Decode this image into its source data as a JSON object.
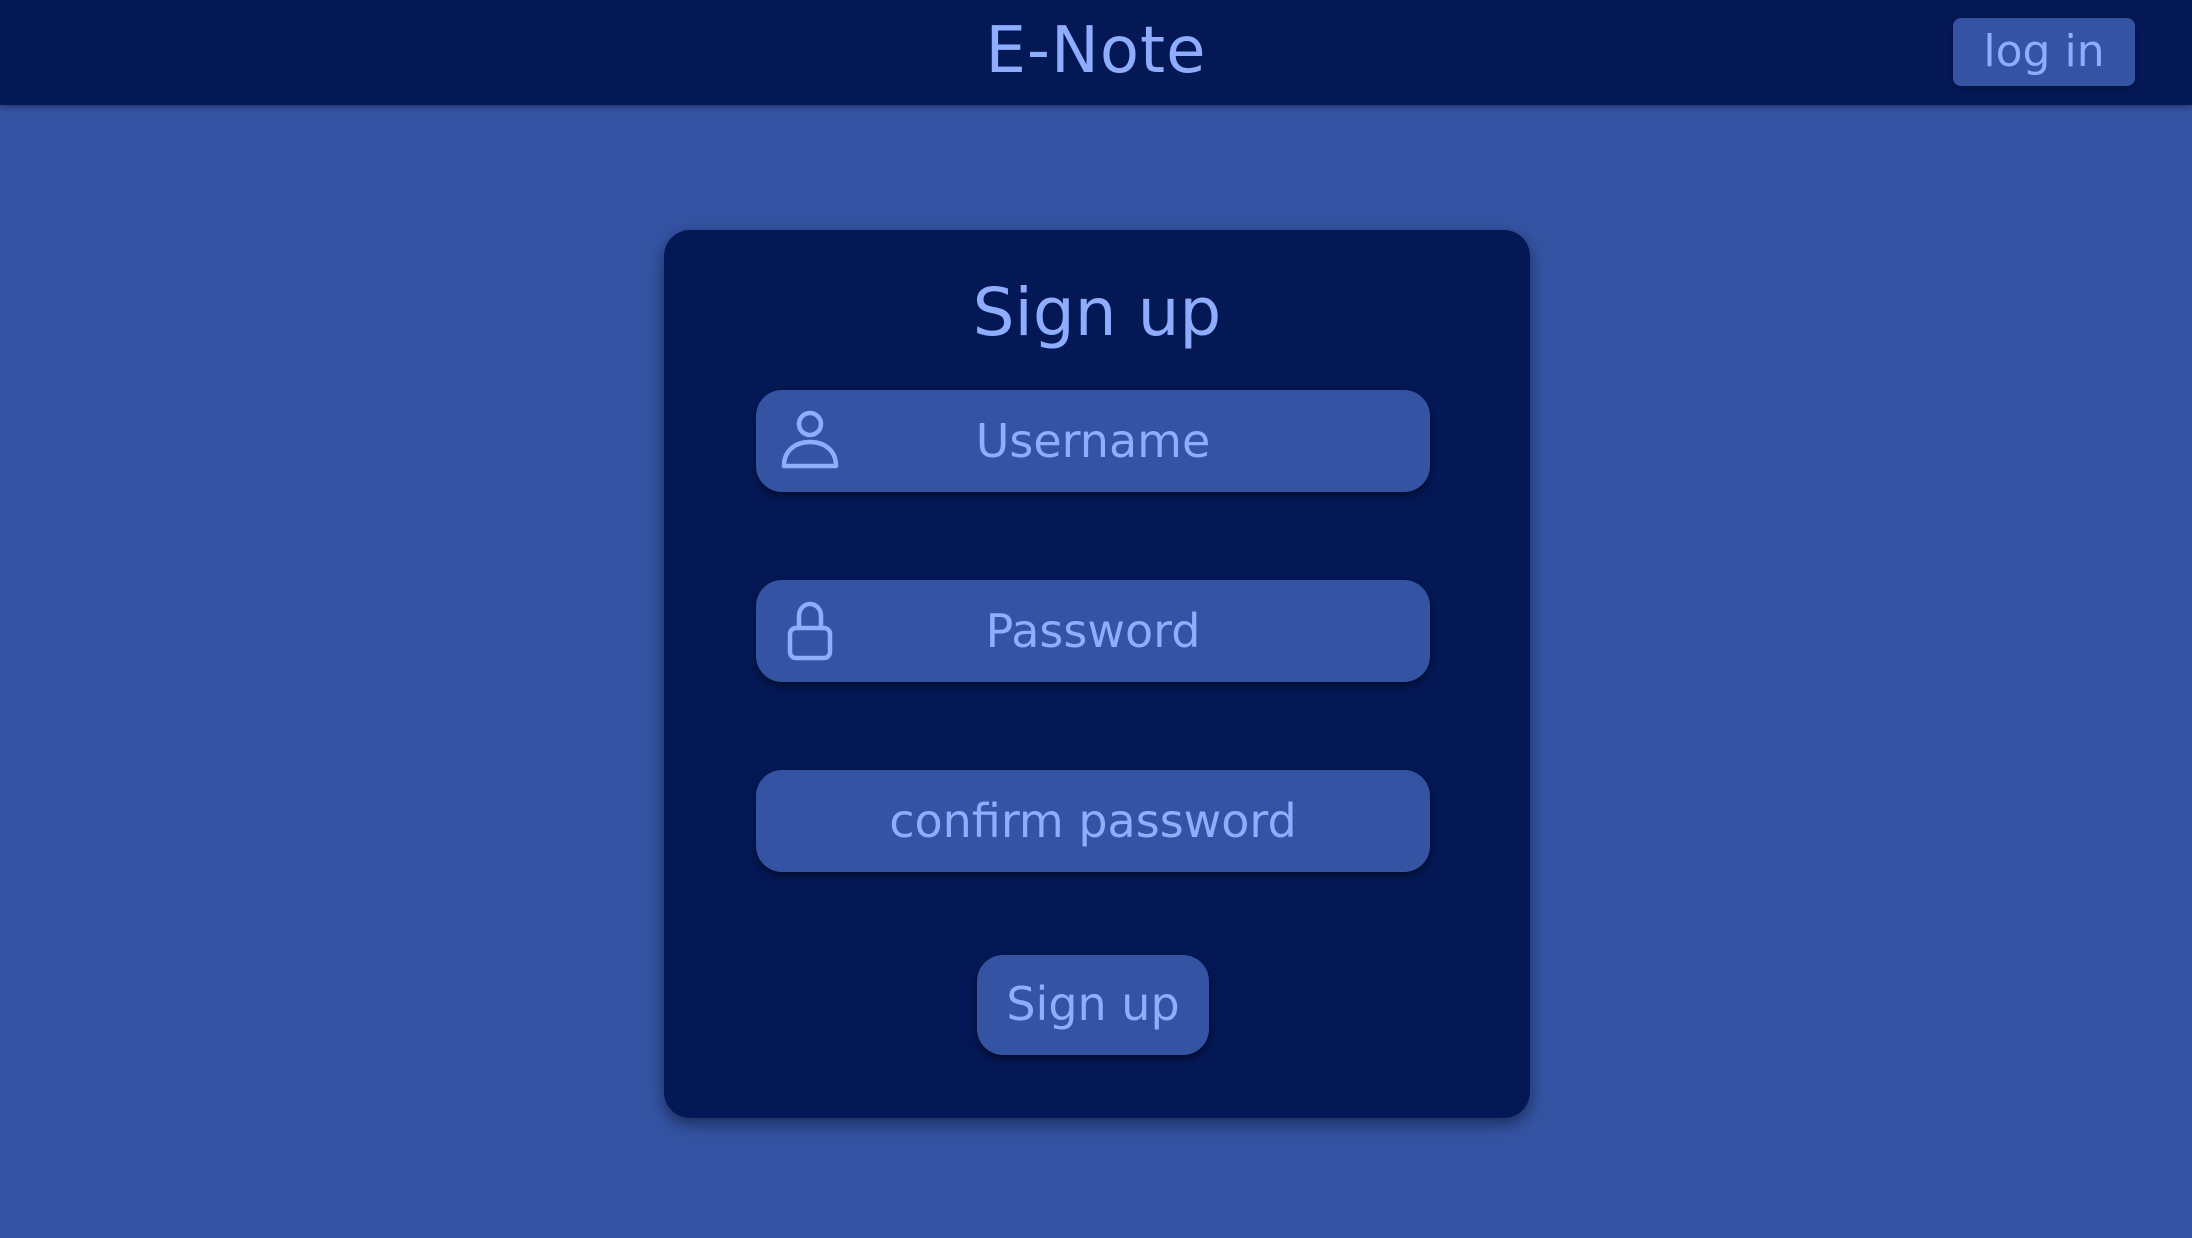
{
  "header": {
    "brand": "E-Note",
    "login_label": "log in"
  },
  "signup": {
    "title": "Sign up",
    "username_placeholder": "Username",
    "password_placeholder": "Password",
    "confirm_placeholder": "confirm password",
    "submit_label": "Sign up"
  },
  "icons": {
    "username": "user-icon",
    "password": "lock-icon"
  },
  "colors": {
    "background": "#3453a3",
    "panel": "#041855",
    "text": "#8fadff"
  }
}
